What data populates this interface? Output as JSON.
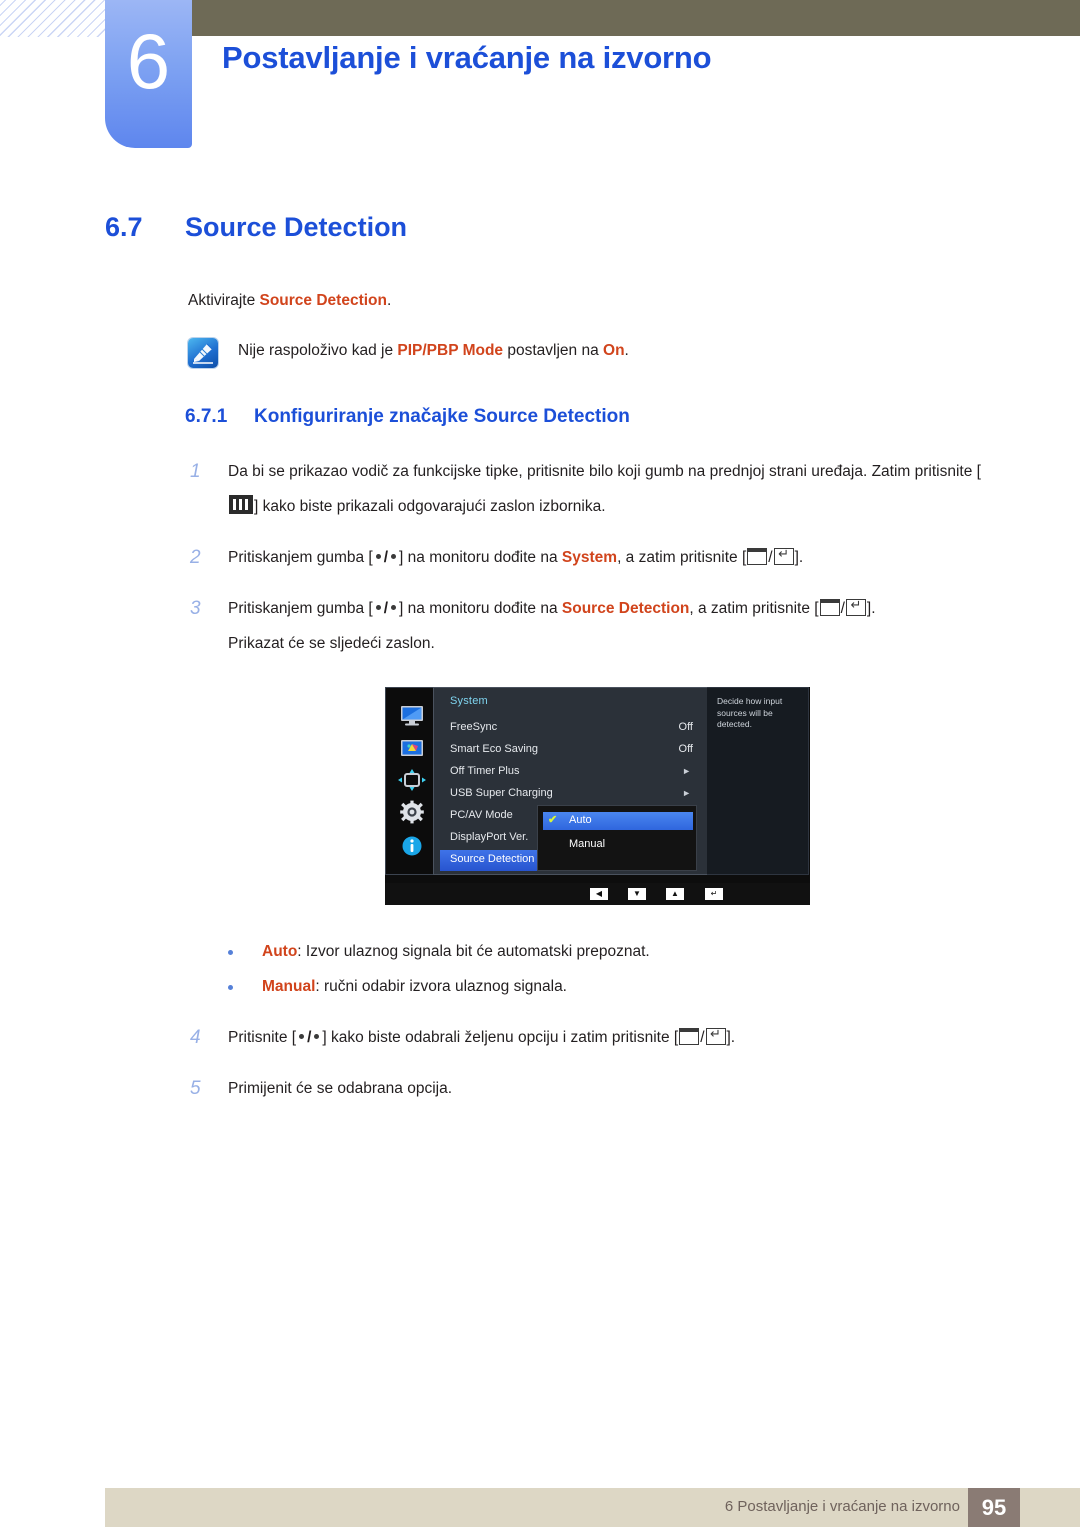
{
  "header": {
    "chapter_number": "6",
    "chapter_title": "Postavljanje i vraćanje na izvorno"
  },
  "section": {
    "number": "6.7",
    "title": "Source Detection",
    "intro_prefix": "Aktivirajte ",
    "intro_keyword": "Source Detection",
    "intro_suffix": ".",
    "note": {
      "icon": "note-icon",
      "text_1": "Nije raspoloživo kad je ",
      "keyword_1": "PIP/PBP Mode",
      "text_2": " postavljen na ",
      "keyword_2": "On",
      "text_3": "."
    }
  },
  "subsection": {
    "number": "6.7.1",
    "title": "Konfiguriranje značajke Source Detection"
  },
  "steps": [
    {
      "number": "1",
      "t1": "Da bi se prikazao vodič za funkcijske tipke, pritisnite bilo koji gumb na prednjoj strani uređaja. Zatim pritisnite [",
      "t2": "] kako biste prikazali odgovarajući zaslon izbornika."
    },
    {
      "number": "2",
      "t1": "Pritiskanjem gumba [",
      "t2": "] na monitoru dođite na ",
      "kw": "System",
      "t3": ", a zatim pritisnite [",
      "t4": "]."
    },
    {
      "number": "3",
      "t1": "Pritiskanjem gumba [",
      "t2": "] na monitoru dođite na ",
      "kw": "Source Detection",
      "t3": ", a zatim pritisnite [",
      "t4": "].",
      "subline": "Prikazat će se sljedeći zaslon."
    },
    {
      "number": "4",
      "t1": "Pritisnite [",
      "t2": "] kako biste odabrali željenu opciju i zatim pritisnite [",
      "t4": "]."
    },
    {
      "number": "5",
      "t1": "Primijenit će se odabrana opcija."
    }
  ],
  "osd": {
    "panel_title": "System",
    "sidebar_icons": [
      "monitor-icon",
      "picture-icon",
      "onscreen-display-icon",
      "gear-icon",
      "information-icon"
    ],
    "rows": [
      {
        "label": "FreeSync",
        "value": "Off",
        "arrow": ""
      },
      {
        "label": "Smart Eco Saving",
        "value": "Off",
        "arrow": ""
      },
      {
        "label": "Off Timer Plus",
        "value": "",
        "arrow": "►"
      },
      {
        "label": "USB Super Charging",
        "value": "",
        "arrow": "►"
      },
      {
        "label": "PC/AV Mode",
        "value": "",
        "arrow": ""
      },
      {
        "label": "DisplayPort Ver.",
        "value": "",
        "arrow": ""
      },
      {
        "label": "Source Detection",
        "value": "",
        "arrow": ""
      }
    ],
    "selected_row": "Source Detection",
    "submenu": {
      "items": [
        {
          "label": "Auto",
          "checked": true,
          "check_glyph": "✔"
        },
        {
          "label": "Manual",
          "checked": false,
          "check_glyph": ""
        }
      ]
    },
    "help_text": "Decide how input sources will be detected.",
    "buttons": [
      "◀",
      "▼",
      "▲",
      "↵"
    ],
    "colors": {
      "panel_bg": "#2b3139",
      "highlight": "#2f66de",
      "title": "#7fd4ef",
      "check": "#d8f53a"
    }
  },
  "bullets": [
    {
      "keyword": "Auto",
      "text": ": Izvor ulaznog signala bit će automatski prepoznat."
    },
    {
      "keyword": "Manual",
      "text": ": ručni odabir izvora ulaznog signala."
    }
  ],
  "footer": {
    "text": "6 Postavljanje i vraćanje na izvorno",
    "page_number": "95"
  },
  "colors": {
    "heading_blue": "#1c4fd8",
    "keyword_red": "#d1441c",
    "olive": "#6e6a56",
    "footer_bg": "#ddd7c5",
    "page_badge_bg": "#8a7b74"
  }
}
